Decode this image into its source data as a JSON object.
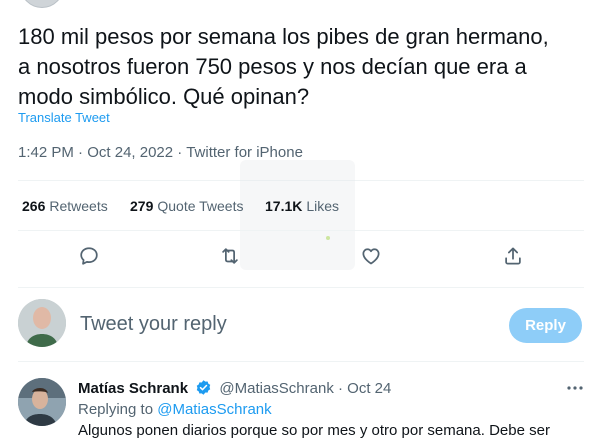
{
  "tweet": {
    "text": "180 mil pesos por semana los pibes de gran hermano,\na nosotros fueron 750 pesos y nos decían que era a\nmodo simbólico. Qué opinan?",
    "translate_label": "Translate Tweet",
    "time": "1:42 PM",
    "date": "Oct 24, 2022",
    "source": "Twitter for iPhone",
    "meta_separator": "·"
  },
  "stats": {
    "retweets": {
      "count": "266",
      "label": "Retweets"
    },
    "quote_tweets": {
      "count": "279",
      "label": "Quote Tweets"
    },
    "likes": {
      "count": "17.1K",
      "label": "Likes"
    }
  },
  "actions": [
    {
      "name": "reply",
      "icon": "reply-icon"
    },
    {
      "name": "retweet",
      "icon": "retweet-icon"
    },
    {
      "name": "like",
      "icon": "heart-icon"
    },
    {
      "name": "share",
      "icon": "share-icon"
    }
  ],
  "compose": {
    "placeholder": "Tweet your reply",
    "button_label": "Reply"
  },
  "reply": {
    "name": "Matías Schrank",
    "handle": "@MatiasSchrank",
    "separator": "·",
    "date": "Oct 24",
    "replying_to_label": "Replying to",
    "replying_to_handle": "@MatiasSchrank",
    "verified_icon": "verified-badge-icon",
    "more_icon": "more-icon",
    "text_start": "Algunos ponen diarios porque so por mes y otro por semana. Debe ser"
  },
  "colors": {
    "accent": "#1d9bf0",
    "text": "#0f1419",
    "secondary": "#536471",
    "reply_button_disabled": "#8ecdf8",
    "divider": "#eff3f4"
  }
}
